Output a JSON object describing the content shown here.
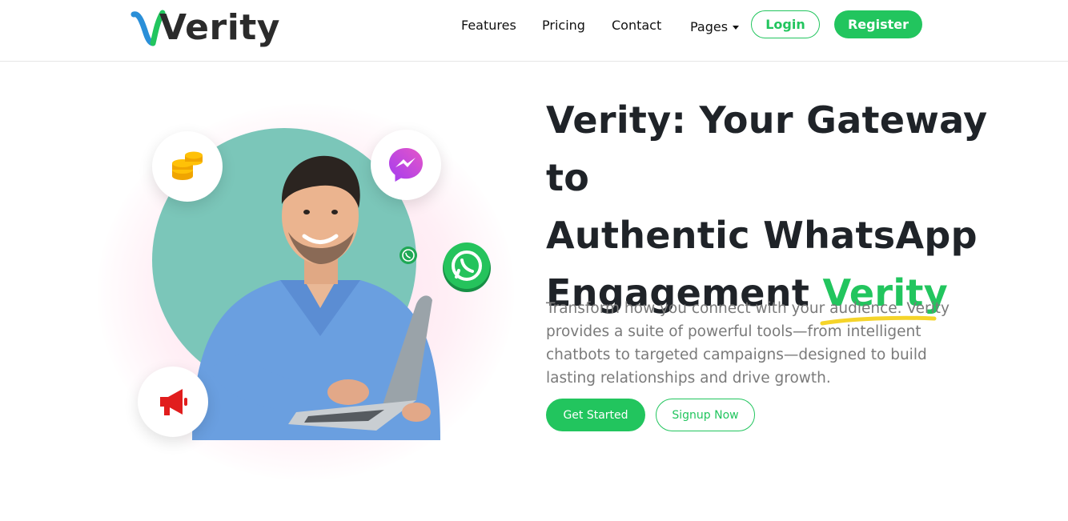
{
  "brand": {
    "name": "Verity",
    "primary_color": "#22c55e",
    "logo_v_colors": [
      "#2a8fd8",
      "#22c55e"
    ]
  },
  "nav": {
    "items": [
      "Features",
      "Pricing",
      "Contact",
      "Pages"
    ],
    "login_label": "Login",
    "register_label": "Register"
  },
  "hero": {
    "headline_line1": "Verity: Your Gateway to",
    "headline_line2": "Authentic WhatsApp",
    "headline_line3": "Engagement",
    "headline_accent": "Verity",
    "paragraph": "Transform how you connect with your audience. Verity provides a suite of powerful tools—from intelligent chatbots to targeted campaigns—designed to build lasting relationships and drive growth.",
    "primary_cta": "Get Started",
    "secondary_cta": "Signup Now",
    "icons": [
      "coins-icon",
      "messenger-icon",
      "megaphone-icon",
      "whatsapp-icon"
    ]
  }
}
